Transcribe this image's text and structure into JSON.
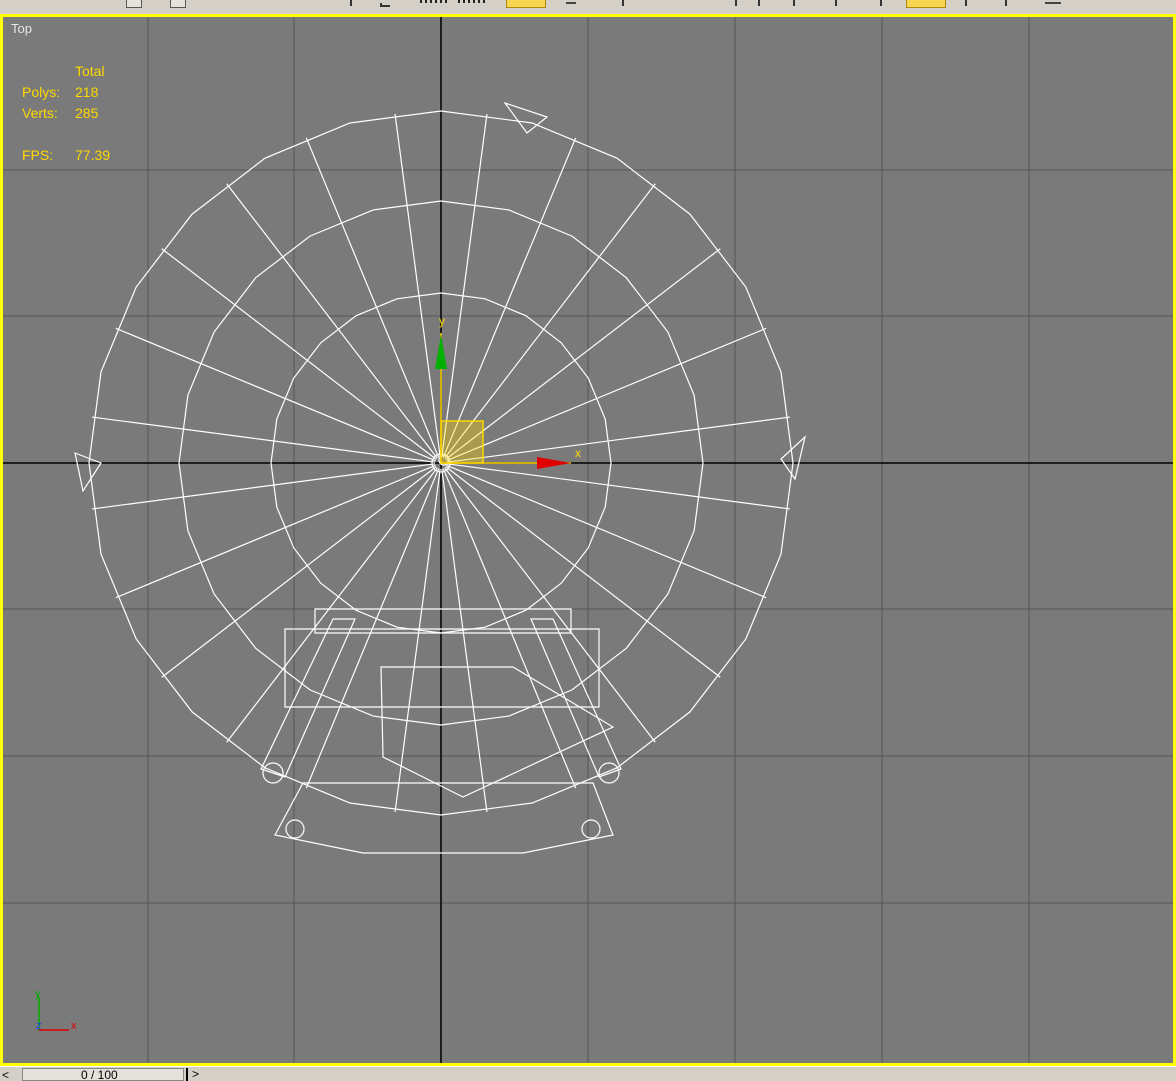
{
  "viewport": {
    "label": "Top",
    "stats": {
      "header": "Total",
      "polys_label": "Polys:",
      "polys_value": "218",
      "verts_label": "Verts:",
      "verts_value": "285",
      "fps_label": "FPS:",
      "fps_value": "77.39"
    },
    "gizmo": {
      "x_label": "x",
      "y_label": "y"
    },
    "tripod": {
      "x_label": "x",
      "y_label": "y",
      "z_label": "z"
    }
  },
  "timeline": {
    "left_arrow": "<",
    "frame_text": "0 / 100",
    "right_arrow": ">"
  },
  "colors": {
    "viewport_bg": "#7a7a7a",
    "active_border": "#ffff00",
    "stats_text": "#ffd800",
    "wireframe": "#ffffff",
    "x_axis": "#e00000",
    "y_axis": "#00b000",
    "z_axis": "#1f3bff"
  }
}
